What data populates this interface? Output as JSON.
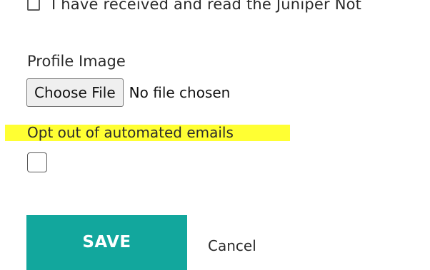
{
  "form": {
    "acknowledgement": {
      "label": "I have received and read the Juniper Not",
      "checked": false
    },
    "profile_image": {
      "label": "Profile Image",
      "choose_button_label": "Choose File",
      "file_status": "No file chosen"
    },
    "opt_out": {
      "label": "Opt out of automated emails",
      "checked": false,
      "highlight_color": "#ffff33"
    },
    "actions": {
      "save_label": "SAVE",
      "cancel_label": "Cancel",
      "save_color": "#12a79d"
    }
  }
}
